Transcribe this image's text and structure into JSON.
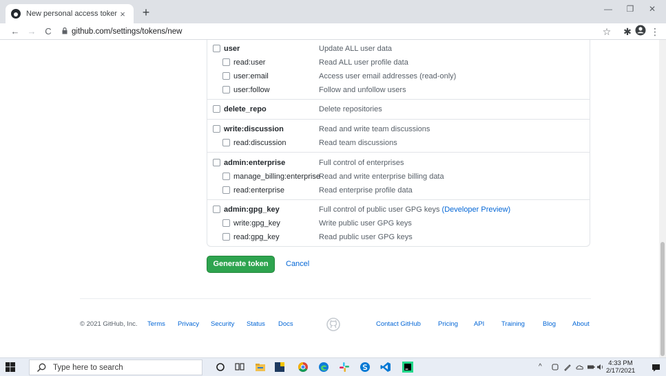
{
  "browser": {
    "tab_title": "New personal access token",
    "tab_close": "×",
    "new_tab": "+",
    "window_controls": [
      "—",
      "❐",
      "✕"
    ],
    "nav": {
      "back": "←",
      "forward": "→",
      "reload": "C"
    },
    "url": "github.com/settings/tokens/new",
    "toolbar_icons": [
      "☆",
      "✱",
      "⋮"
    ]
  },
  "scopes": {
    "groups": [
      {
        "parent": {
          "name": "user",
          "desc": "Update ALL user data"
        },
        "children": [
          {
            "name": "read:user",
            "desc": "Read ALL user profile data"
          },
          {
            "name": "user:email",
            "desc": "Access user email addresses (read-only)"
          },
          {
            "name": "user:follow",
            "desc": "Follow and unfollow users"
          }
        ]
      },
      {
        "parent": {
          "name": "delete_repo",
          "desc": "Delete repositories"
        },
        "children": []
      },
      {
        "parent": {
          "name": "write:discussion",
          "desc": "Read and write team discussions"
        },
        "children": [
          {
            "name": "read:discussion",
            "desc": "Read team discussions"
          }
        ]
      },
      {
        "parent": {
          "name": "admin:enterprise",
          "desc": "Full control of enterprises"
        },
        "children": [
          {
            "name": "manage_billing:enterprise",
            "desc": "Read and write enterprise billing data"
          },
          {
            "name": "read:enterprise",
            "desc": "Read enterprise profile data"
          }
        ]
      },
      {
        "parent": {
          "name": "admin:gpg_key",
          "desc": "Full control of public user GPG keys",
          "link": "(Developer Preview)"
        },
        "children": [
          {
            "name": "write:gpg_key",
            "desc": "Write public user GPG keys"
          },
          {
            "name": "read:gpg_key",
            "desc": "Read public user GPG keys"
          }
        ]
      }
    ]
  },
  "actions": {
    "generate": "Generate token",
    "cancel": "Cancel"
  },
  "footer": {
    "copyright": "© 2021 GitHub, Inc.",
    "left_links": [
      "Terms",
      "Privacy",
      "Security",
      "Status",
      "Docs"
    ],
    "right_links": [
      "Contact GitHub",
      "Pricing",
      "API",
      "Training",
      "Blog",
      "About"
    ]
  },
  "taskbar": {
    "search_placeholder": "Type here to search",
    "time": "4:33 PM",
    "date": "2/17/2021"
  },
  "colors": {
    "primary_green": "#2ea44f",
    "link_blue": "#0366d6",
    "border": "#e1e4e8"
  }
}
